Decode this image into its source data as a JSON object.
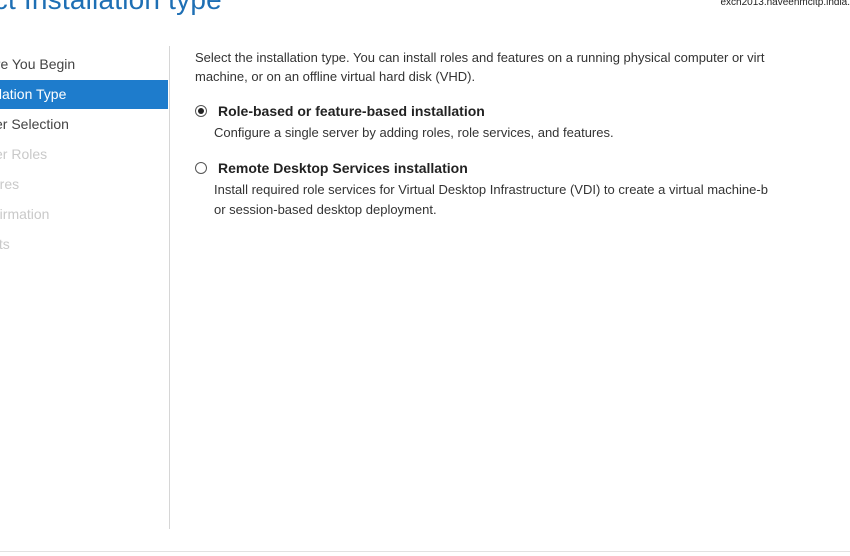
{
  "header": {
    "title": "ect Installation type",
    "server_name": "exch2013.naveenmcitp.india."
  },
  "nav": {
    "items": [
      {
        "label": "ore You Begin",
        "state": "normal"
      },
      {
        "label": "allation Type",
        "state": "active"
      },
      {
        "label": "ver Selection",
        "state": "normal"
      },
      {
        "label": "ver Roles",
        "state": "disabled"
      },
      {
        "label": "tures",
        "state": "disabled"
      },
      {
        "label": "nfirmation",
        "state": "disabled"
      },
      {
        "label": "ults",
        "state": "disabled"
      }
    ]
  },
  "content": {
    "intro_line1": "Select the installation type. You can install roles and features on a running physical computer or virt",
    "intro_line2": "machine, or on an offline virtual hard disk (VHD).",
    "options": [
      {
        "label": "Role-based or feature-based installation",
        "selected": true,
        "desc_line1": "Configure a single server by adding roles, role services, and features.",
        "desc_line2": ""
      },
      {
        "label": "Remote Desktop Services installation",
        "selected": false,
        "desc_line1": "Install required role services for Virtual Desktop Infrastructure (VDI) to create a virtual machine-b",
        "desc_line2": "or session-based desktop deployment."
      }
    ]
  },
  "colors": {
    "accent": "#1e7ccc",
    "title": "#1e6fb4",
    "disabled_text": "#c9c9c9"
  }
}
